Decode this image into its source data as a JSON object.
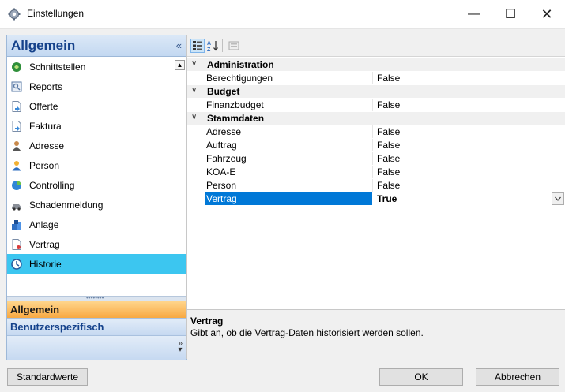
{
  "window": {
    "title": "Einstellungen",
    "minimize": "—",
    "maximize": "☐",
    "close": "✕"
  },
  "sidebar": {
    "header": "Allgemein",
    "collapse_glyph": "«",
    "items": [
      {
        "label": "Schnittstellen",
        "icon": "interface-icon"
      },
      {
        "label": "Reports",
        "icon": "report-icon"
      },
      {
        "label": "Offerte",
        "icon": "document-icon"
      },
      {
        "label": "Faktura",
        "icon": "invoice-icon"
      },
      {
        "label": "Adresse",
        "icon": "address-icon"
      },
      {
        "label": "Person",
        "icon": "person-icon"
      },
      {
        "label": "Controlling",
        "icon": "controlling-icon"
      },
      {
        "label": "Schadenmeldung",
        "icon": "damage-icon"
      },
      {
        "label": "Anlage",
        "icon": "asset-icon"
      },
      {
        "label": "Vertrag",
        "icon": "contract-icon"
      },
      {
        "label": "Historie",
        "icon": "history-icon",
        "selected": true
      }
    ],
    "nav_buttons": [
      "Allgemein",
      "Benutzerspezifisch"
    ]
  },
  "grid": {
    "rows": [
      {
        "type": "category",
        "label": "Administration"
      },
      {
        "type": "prop",
        "name": "Berechtigungen",
        "value": "False"
      },
      {
        "type": "category",
        "label": "Budget"
      },
      {
        "type": "prop",
        "name": "Finanzbudget",
        "value": "False"
      },
      {
        "type": "category",
        "label": "Stammdaten"
      },
      {
        "type": "prop",
        "name": "Adresse",
        "value": "False"
      },
      {
        "type": "prop",
        "name": "Auftrag",
        "value": "False"
      },
      {
        "type": "prop",
        "name": "Fahrzeug",
        "value": "False"
      },
      {
        "type": "prop",
        "name": "KOA-E",
        "value": "False"
      },
      {
        "type": "prop",
        "name": "Person",
        "value": "False"
      },
      {
        "type": "prop",
        "name": "Vertrag",
        "value": "True",
        "selected": true
      }
    ]
  },
  "description": {
    "title": "Vertrag",
    "text": "Gibt an, ob die Vertrag-Daten historisiert werden sollen."
  },
  "buttons": {
    "defaults": "Standardwerte",
    "ok": "OK",
    "cancel": "Abbrechen"
  },
  "colors": {
    "selection": "#0078d7",
    "sidebar_selected": "#3cc6f0",
    "active_nav": "#f8a942",
    "header_text": "#15428b"
  }
}
